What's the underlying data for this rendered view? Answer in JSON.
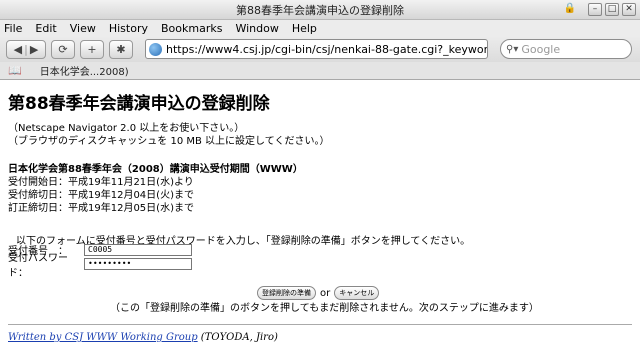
{
  "window": {
    "title": "第88春季年会講演申込の登録削除",
    "controls": [
      "–",
      "□",
      "✕"
    ]
  },
  "menu": [
    "File",
    "Edit",
    "View",
    "History",
    "Bookmarks",
    "Window",
    "Help"
  ],
  "nav": {
    "url": "https://www4.csj.jp/cgi-bin/csj/nenkai-88-gate.cgi?_keyword",
    "search_placeholder": "Google"
  },
  "bookmarks": [
    {
      "label": "日本化学会...2008)"
    }
  ],
  "page": {
    "heading": "第88春季年会講演申込の登録削除",
    "notes": [
      "（Netscape Navigator 2.0 以上をお使い下さい。）",
      "（ブラウザのディスクキャッシュを 10 MB 以上に設定してください。）"
    ],
    "period_heading": "日本化学会第88春季年会（2008）講演申込受付期間（WWW）",
    "period_lines": [
      "受付開始日：平成19年11月21日(水)より",
      "受付締切日：平成19年12月04日(火)まで",
      "訂正締切日：平成19年12月05日(水)まで"
    ],
    "instruction": "以下のフォームに受付番号と受付パスワードを入力し、「登録削除の準備」ボタンを押してください。",
    "form": {
      "number_label": "受付番号　：",
      "number_value": "C0005",
      "password_label": "受付パスワード：",
      "password_value": "•••••••••"
    },
    "buttons": {
      "prepare": "登録削除の準備",
      "or": "or",
      "cancel": "キャンセル"
    },
    "caption": "（この「登録削除の準備」のボタンを押してもまだ削除されません。次のステップに進みます）",
    "footer": {
      "link": "Written by CSJ WWW Working Group",
      "author": " (TOYODA, Jiro)"
    }
  }
}
